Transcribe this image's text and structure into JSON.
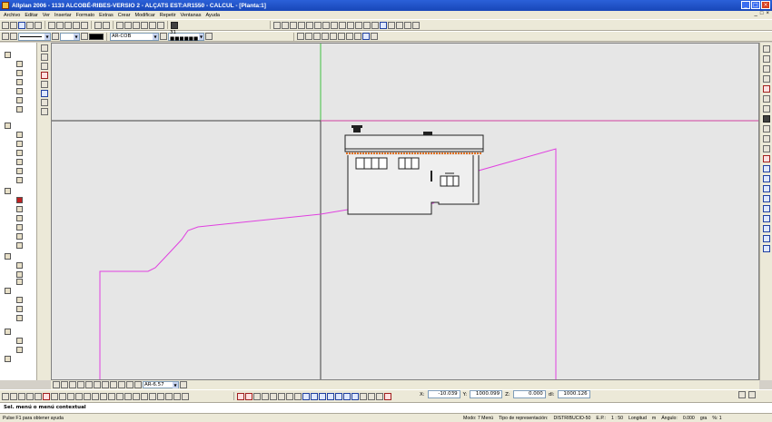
{
  "window": {
    "title": "Allplan 2006 - 1133 ALCOBÉ-RIBES-VERSIO 2 - ALÇATS EST:AR1550 - CALCUL - [Planta:1]",
    "controls": [
      "_",
      "□",
      "×"
    ]
  },
  "menu": {
    "items": [
      "Archivo",
      "Editar",
      "Ver",
      "Insertar",
      "Formato",
      "Extras",
      "Crear",
      "Modificar",
      "Repetir",
      "Ventanas",
      "Ayuda"
    ],
    "right_controls": [
      "_",
      "□",
      "×"
    ]
  },
  "toolbar2": {
    "layer_value": "AR-COB",
    "scale_value": "31 ■■■■■■",
    "pen_color": "#000000"
  },
  "viewbar": {
    "zoom_value": "AR-6.57"
  },
  "coords": {
    "x_label": "X:",
    "x_value": "-10.039",
    "y_label": "Y:",
    "y_value": "1000.099",
    "z_label": "Z:",
    "z_value": "0.000",
    "dl_label": "dl:",
    "dl_value": "1000.126"
  },
  "prompt": {
    "text": "Sel. menú o menú contextual"
  },
  "statusbar": {
    "help": "Pulse F1 para obtener ayuda",
    "mode": "Modo: 7 Menú",
    "rep_label": "Tipo de representación:",
    "rep_value": "DISTRIBUCIO-50",
    "scale_label": "E.P.:",
    "scale_value": "1 : 50",
    "length_label": "Longitud",
    "length_unit": "m",
    "angle_label": "Ángulo:",
    "angle_value": "0.000",
    "angle_unit": "gra",
    "percent": "%: 1"
  },
  "colors": {
    "canvas_bg": "#e6e6e6",
    "crosshair_h": "#d040a0",
    "crosshair_v": "#40c040",
    "terrain": "#e040e0",
    "building": "#202020",
    "accent": "#e07020"
  }
}
